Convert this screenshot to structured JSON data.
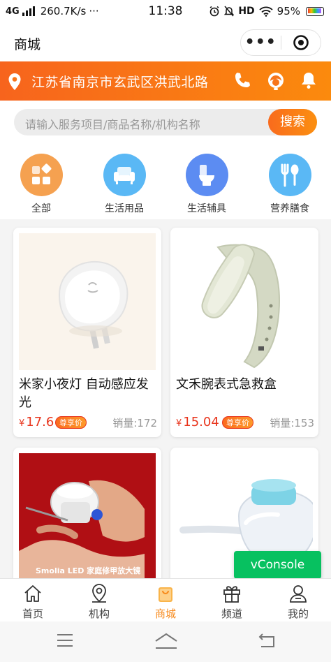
{
  "status_bar": {
    "network": "4G",
    "speed": "260.7K/s",
    "dots": "···",
    "time": "11:38",
    "hd": "HD",
    "battery": "95%"
  },
  "title_bar": {
    "title": "商城",
    "more_icon": "more-dots-icon",
    "close_icon": "target-circle-icon"
  },
  "location_bar": {
    "address": "江苏省南京市玄武区洪武北路",
    "icons": [
      "phone-icon",
      "customer-service-icon",
      "bell-icon"
    ],
    "accent": "#f7641d"
  },
  "search": {
    "placeholder": "请输入服务项目/商品名称/机构名称",
    "button": "搜索"
  },
  "categories": [
    {
      "label": "全部",
      "icon": "grid-icon",
      "color": "#f5a150"
    },
    {
      "label": "生活用品",
      "icon": "sofa-icon",
      "color": "#5ab8f5"
    },
    {
      "label": "生活辅具",
      "icon": "toilet-icon",
      "color": "#5c8cf2"
    },
    {
      "label": "营养膳食",
      "icon": "fork-spoon-icon",
      "color": "#5ab8f5"
    }
  ],
  "products": [
    {
      "name": "米家小夜灯 自动感应发光",
      "currency": "¥",
      "price": "17.6",
      "tag": "尊享价",
      "sold": "销量:172",
      "image": "night-light-image"
    },
    {
      "name": "文禾腕表式急救盒",
      "currency": "¥",
      "price": "15.04",
      "tag": "尊享价",
      "sold": "销量:153",
      "image": "wristband-image"
    },
    {
      "name": "",
      "currency": "",
      "price": "",
      "tag": "",
      "sold": "",
      "image": "magnifier-image",
      "image_caption": "Smolia LED 家庭修甲放大镜"
    },
    {
      "name": "",
      "currency": "",
      "price": "",
      "tag": "",
      "sold": "",
      "image": "feeding-cup-image"
    }
  ],
  "vconsole": "vConsole",
  "tabs": [
    {
      "label": "首页",
      "icon": "home-icon",
      "active": false
    },
    {
      "label": "机构",
      "icon": "location-icon",
      "active": false
    },
    {
      "label": "商城",
      "icon": "shopping-bag-icon",
      "active": true
    },
    {
      "label": "频道",
      "icon": "gift-icon",
      "active": false
    },
    {
      "label": "我的",
      "icon": "user-icon",
      "active": false
    }
  ],
  "system_nav": [
    "menu-icon",
    "home-nav-icon",
    "back-icon"
  ]
}
